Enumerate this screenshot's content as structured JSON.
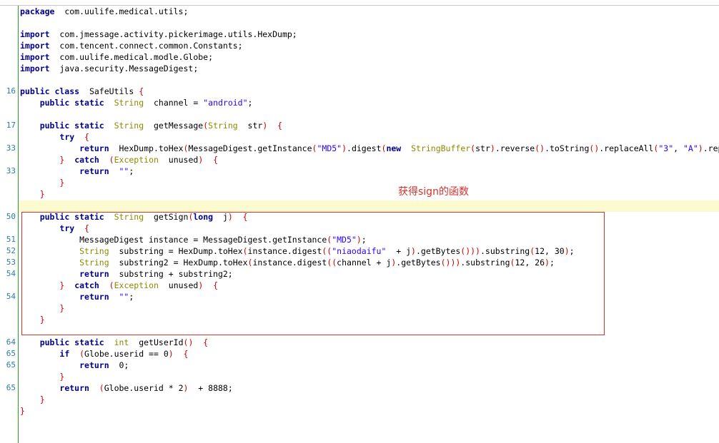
{
  "annotation": {
    "text": "获得sign的函数"
  },
  "colors": {
    "keyword": "#00008b",
    "type": "#8b8b00",
    "string": "#2a00ff",
    "bracket": "#cc0000",
    "line_number": "#2a7fa0",
    "gutter_separator": "#2e9b2e",
    "current_line_highlight": "#fbfbcf",
    "annotation": "#d8312b"
  },
  "lines": [
    {
      "n": "",
      "tokens": [
        [
          "kw",
          "package"
        ],
        [
          "",
          "  com.uulife.medical.utils;"
        ]
      ]
    },
    {
      "n": "",
      "tokens": []
    },
    {
      "n": "",
      "tokens": [
        [
          "kw",
          "import"
        ],
        [
          "",
          "  com.jmessage.activity.pickerimage.utils.HexDump;"
        ]
      ]
    },
    {
      "n": "",
      "tokens": [
        [
          "kw",
          "import"
        ],
        [
          "",
          "  com.tencent.connect.common.Constants;"
        ]
      ]
    },
    {
      "n": "",
      "tokens": [
        [
          "kw",
          "import"
        ],
        [
          "",
          "  com.uulife.medical.modle.Globe;"
        ]
      ]
    },
    {
      "n": "",
      "tokens": [
        [
          "kw",
          "import"
        ],
        [
          "",
          "  java.security.MessageDigest;"
        ]
      ]
    },
    {
      "n": "",
      "tokens": []
    },
    {
      "n": "16",
      "tokens": [
        [
          "kw",
          "public class"
        ],
        [
          "",
          "  SafeUtils "
        ],
        [
          "br",
          "{"
        ]
      ]
    },
    {
      "n": "",
      "tokens": [
        [
          "",
          "    "
        ],
        [
          "kw",
          "public static"
        ],
        [
          "",
          "  "
        ],
        [
          "ty",
          "String"
        ],
        [
          "",
          "  channel = "
        ],
        [
          "st",
          "\"android\""
        ],
        [
          "",
          ";"
        ]
      ]
    },
    {
      "n": "",
      "tokens": []
    },
    {
      "n": "17",
      "tokens": [
        [
          "",
          "    "
        ],
        [
          "kw",
          "public static"
        ],
        [
          "",
          "  "
        ],
        [
          "ty",
          "String"
        ],
        [
          "",
          "  getMessage"
        ],
        [
          "br",
          "("
        ],
        [
          "ty",
          "String"
        ],
        [
          "",
          "  str"
        ],
        [
          "br",
          ")"
        ],
        [
          "",
          "  "
        ],
        [
          "br",
          "{"
        ]
      ]
    },
    {
      "n": "",
      "tokens": [
        [
          "",
          "        "
        ],
        [
          "kw",
          "try"
        ],
        [
          "",
          "  "
        ],
        [
          "br",
          "{"
        ]
      ]
    },
    {
      "n": "33",
      "tokens": [
        [
          "",
          "            "
        ],
        [
          "kw",
          "return"
        ],
        [
          "",
          "  HexDump.toHex"
        ],
        [
          "br",
          "("
        ],
        [
          "",
          "MessageDigest.getInstance"
        ],
        [
          "br",
          "("
        ],
        [
          "st",
          "\"MD5\""
        ],
        [
          "br",
          ")"
        ],
        [
          "",
          ".digest"
        ],
        [
          "br",
          "("
        ],
        [
          "kw",
          "new"
        ],
        [
          "",
          "  "
        ],
        [
          "ty",
          "StringBuffer"
        ],
        [
          "br",
          "("
        ],
        [
          "",
          "str"
        ],
        [
          "br",
          ")"
        ],
        [
          "",
          ".reverse"
        ],
        [
          "br",
          "()"
        ],
        [
          "",
          ".toString"
        ],
        [
          "br",
          "()"
        ],
        [
          "",
          ".replaceAll"
        ],
        [
          "br",
          "("
        ],
        [
          "st",
          "\"3\""
        ],
        [
          "",
          ", "
        ],
        [
          "st",
          "\"A\""
        ],
        [
          "br",
          ")"
        ],
        [
          "",
          ".replace"
        ]
      ]
    },
    {
      "n": "",
      "tokens": [
        [
          "",
          "        "
        ],
        [
          "br",
          "}"
        ],
        [
          "",
          "  "
        ],
        [
          "kw",
          "catch"
        ],
        [
          "",
          "  "
        ],
        [
          "br",
          "("
        ],
        [
          "ty",
          "Exception"
        ],
        [
          "",
          "  unused"
        ],
        [
          "br",
          ")"
        ],
        [
          "",
          "  "
        ],
        [
          "br",
          "{"
        ]
      ]
    },
    {
      "n": "33",
      "tokens": [
        [
          "",
          "            "
        ],
        [
          "kw",
          "return"
        ],
        [
          "",
          "  "
        ],
        [
          "st",
          "\"\""
        ],
        [
          "",
          ";"
        ]
      ]
    },
    {
      "n": "",
      "tokens": [
        [
          "",
          "        "
        ],
        [
          "br",
          "}"
        ]
      ]
    },
    {
      "n": "",
      "tokens": [
        [
          "",
          "    "
        ],
        [
          "br",
          "}"
        ]
      ]
    },
    {
      "n": "",
      "tokens": []
    },
    {
      "n": "50",
      "tokens": [
        [
          "",
          "    "
        ],
        [
          "kw",
          "public static"
        ],
        [
          "",
          "  "
        ],
        [
          "ty",
          "String"
        ],
        [
          "",
          "  getSign"
        ],
        [
          "br",
          "("
        ],
        [
          "kw",
          "long"
        ],
        [
          "",
          "  j"
        ],
        [
          "br",
          ")"
        ],
        [
          "",
          "  "
        ],
        [
          "br",
          "{"
        ]
      ]
    },
    {
      "n": "",
      "tokens": [
        [
          "",
          "        "
        ],
        [
          "kw",
          "try"
        ],
        [
          "",
          "  "
        ],
        [
          "br",
          "{"
        ]
      ]
    },
    {
      "n": "51",
      "tokens": [
        [
          "",
          "            MessageDigest instance = MessageDigest.getInstance"
        ],
        [
          "br",
          "("
        ],
        [
          "st",
          "\"MD5\""
        ],
        [
          "br",
          ")"
        ],
        [
          "",
          ";"
        ]
      ]
    },
    {
      "n": "52",
      "tokens": [
        [
          "",
          "            "
        ],
        [
          "ty",
          "String"
        ],
        [
          "",
          "  substring = HexDump.toHex"
        ],
        [
          "br",
          "("
        ],
        [
          "",
          "instance.digest"
        ],
        [
          "br",
          "(("
        ],
        [
          "st",
          "\"niaodaifu\""
        ],
        [
          "",
          "  + j"
        ],
        [
          "br",
          ")"
        ],
        [
          "",
          ".getBytes"
        ],
        [
          "br",
          "()))"
        ],
        [
          "",
          ".substring"
        ],
        [
          "br",
          "("
        ],
        [
          "",
          "12, 30"
        ],
        [
          "br",
          ")"
        ],
        [
          "",
          ";"
        ]
      ]
    },
    {
      "n": "53",
      "tokens": [
        [
          "",
          "            "
        ],
        [
          "ty",
          "String"
        ],
        [
          "",
          "  substring2 = HexDump.toHex"
        ],
        [
          "br",
          "("
        ],
        [
          "",
          "instance.digest"
        ],
        [
          "br",
          "(("
        ],
        [
          "",
          "channel + j"
        ],
        [
          "br",
          ")"
        ],
        [
          "",
          ".getBytes"
        ],
        [
          "br",
          "()))"
        ],
        [
          "",
          ".substring"
        ],
        [
          "br",
          "("
        ],
        [
          "",
          "12, 26"
        ],
        [
          "br",
          ")"
        ],
        [
          "",
          ";"
        ]
      ]
    },
    {
      "n": "54",
      "tokens": [
        [
          "",
          "            "
        ],
        [
          "kw",
          "return"
        ],
        [
          "",
          "  substring + substring2;"
        ]
      ]
    },
    {
      "n": "",
      "tokens": [
        [
          "",
          "        "
        ],
        [
          "br",
          "}"
        ],
        [
          "",
          "  "
        ],
        [
          "kw",
          "catch"
        ],
        [
          "",
          "  "
        ],
        [
          "br",
          "("
        ],
        [
          "ty",
          "Exception"
        ],
        [
          "",
          "  unused"
        ],
        [
          "br",
          ")"
        ],
        [
          "",
          "  "
        ],
        [
          "br",
          "{"
        ]
      ]
    },
    {
      "n": "54",
      "tokens": [
        [
          "",
          "            "
        ],
        [
          "kw",
          "return"
        ],
        [
          "",
          "  "
        ],
        [
          "st",
          "\"\""
        ],
        [
          "",
          ";"
        ]
      ]
    },
    {
      "n": "",
      "tokens": [
        [
          "",
          "        "
        ],
        [
          "br",
          "}"
        ]
      ]
    },
    {
      "n": "",
      "tokens": [
        [
          "",
          "    "
        ],
        [
          "br",
          "}"
        ]
      ]
    },
    {
      "n": "",
      "tokens": []
    },
    {
      "n": "64",
      "tokens": [
        [
          "",
          "    "
        ],
        [
          "kw",
          "public static"
        ],
        [
          "",
          "  "
        ],
        [
          "ty",
          "int"
        ],
        [
          "",
          "  getUserId"
        ],
        [
          "br",
          "()"
        ],
        [
          "",
          "  "
        ],
        [
          "br",
          "{"
        ]
      ]
    },
    {
      "n": "65",
      "tokens": [
        [
          "",
          "        "
        ],
        [
          "kw",
          "if"
        ],
        [
          "",
          "  "
        ],
        [
          "br",
          "("
        ],
        [
          "",
          "Globe.userid == 0"
        ],
        [
          "br",
          ")"
        ],
        [
          "",
          "  "
        ],
        [
          "br",
          "{"
        ]
      ]
    },
    {
      "n": "65",
      "tokens": [
        [
          "",
          "            "
        ],
        [
          "kw",
          "return"
        ],
        [
          "",
          "  0;"
        ]
      ]
    },
    {
      "n": "",
      "tokens": [
        [
          "",
          "        "
        ],
        [
          "br",
          "}"
        ]
      ]
    },
    {
      "n": "65",
      "tokens": [
        [
          "",
          "        "
        ],
        [
          "kw",
          "return"
        ],
        [
          "",
          "  "
        ],
        [
          "br",
          "("
        ],
        [
          "",
          "Globe.userid * 2"
        ],
        [
          "br",
          ")"
        ],
        [
          "",
          "  + 8888;"
        ]
      ]
    },
    {
      "n": "",
      "tokens": [
        [
          "",
          "    "
        ],
        [
          "br",
          "}"
        ]
      ]
    },
    {
      "n": "",
      "tokens": [
        [
          "br",
          "}"
        ]
      ]
    }
  ]
}
